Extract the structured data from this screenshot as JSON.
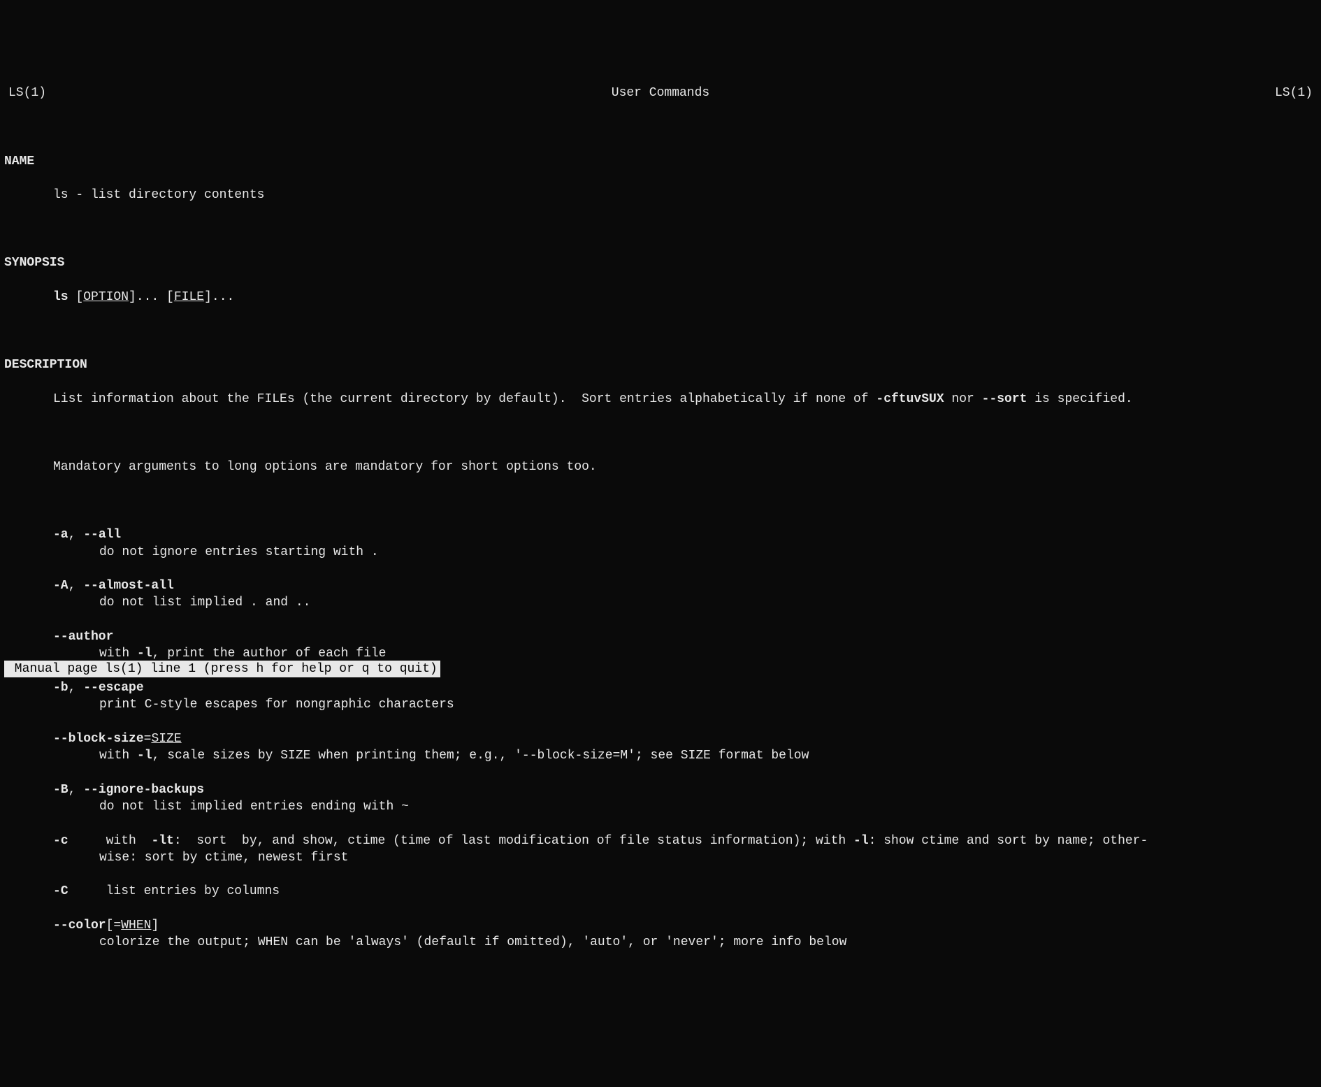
{
  "header": {
    "left": "LS(1)",
    "center": "User Commands",
    "right": "LS(1)"
  },
  "sections": {
    "name": {
      "heading": "NAME",
      "text": "ls - list directory contents"
    },
    "synopsis": {
      "heading": "SYNOPSIS",
      "cmd": "ls",
      "option_label": "OPTION",
      "file_label": "FILE",
      "ellipsis": "..."
    },
    "description": {
      "heading": "DESCRIPTION",
      "intro_pre": "List information about the FILEs (the current directory by default).  Sort entries alphabetically if none of ",
      "intro_bold1": "-cftuvSUX",
      "intro_mid": " nor ",
      "intro_bold2": "--sort",
      "intro_post": " is specified.",
      "mandatory": "Mandatory arguments to long options are mandatory for short options too.",
      "options": [
        {
          "flags": [
            {
              "b": "-a"
            },
            {
              "t": ", "
            },
            {
              "b": "--all"
            }
          ],
          "desc": [
            {
              "t": "do not ignore entries starting with ."
            }
          ]
        },
        {
          "flags": [
            {
              "b": "-A"
            },
            {
              "t": ", "
            },
            {
              "b": "--almost-all"
            }
          ],
          "desc": [
            {
              "t": "do not list implied . and .."
            }
          ]
        },
        {
          "flags": [
            {
              "b": "--author"
            }
          ],
          "desc": [
            {
              "t": "with "
            },
            {
              "b": "-l"
            },
            {
              "t": ", print the author of each file"
            }
          ]
        },
        {
          "flags": [
            {
              "b": "-b"
            },
            {
              "t": ", "
            },
            {
              "b": "--escape"
            }
          ],
          "desc": [
            {
              "t": "print C-style escapes for nongraphic characters"
            }
          ]
        },
        {
          "flags": [
            {
              "b": "--block-size"
            },
            {
              "t": "="
            },
            {
              "u": "SIZE"
            }
          ],
          "desc": [
            {
              "t": "with "
            },
            {
              "b": "-l"
            },
            {
              "t": ", scale sizes by SIZE when printing them; e.g., '--block-size=M'; see SIZE format below"
            }
          ]
        },
        {
          "flags": [
            {
              "b": "-B"
            },
            {
              "t": ", "
            },
            {
              "b": "--ignore-backups"
            }
          ],
          "desc": [
            {
              "t": "do not list implied entries ending with ~"
            }
          ]
        },
        {
          "inline": true,
          "flags": [
            {
              "b": "-c"
            }
          ],
          "desc": [
            {
              "t": "     with  "
            },
            {
              "b": "-lt"
            },
            {
              "t": ":  sort  by, and show, ctime (time of last modification of file status information); with "
            },
            {
              "b": "-l"
            },
            {
              "t": ": show ctime and sort by name; other‐"
            }
          ],
          "cont": "wise: sort by ctime, newest first"
        },
        {
          "inline": true,
          "flags": [
            {
              "b": "-C"
            }
          ],
          "desc": [
            {
              "t": "     list entries by columns"
            }
          ]
        },
        {
          "flags": [
            {
              "b": "--color"
            },
            {
              "t": "[="
            },
            {
              "u": "WHEN"
            },
            {
              "t": "]"
            }
          ],
          "desc": [
            {
              "t": "colorize the output; WHEN can be 'always' (default if omitted), 'auto', or 'never'; more info below"
            }
          ]
        }
      ]
    }
  },
  "status": " Manual page ls(1) line 1 (press h for help or q to quit)"
}
